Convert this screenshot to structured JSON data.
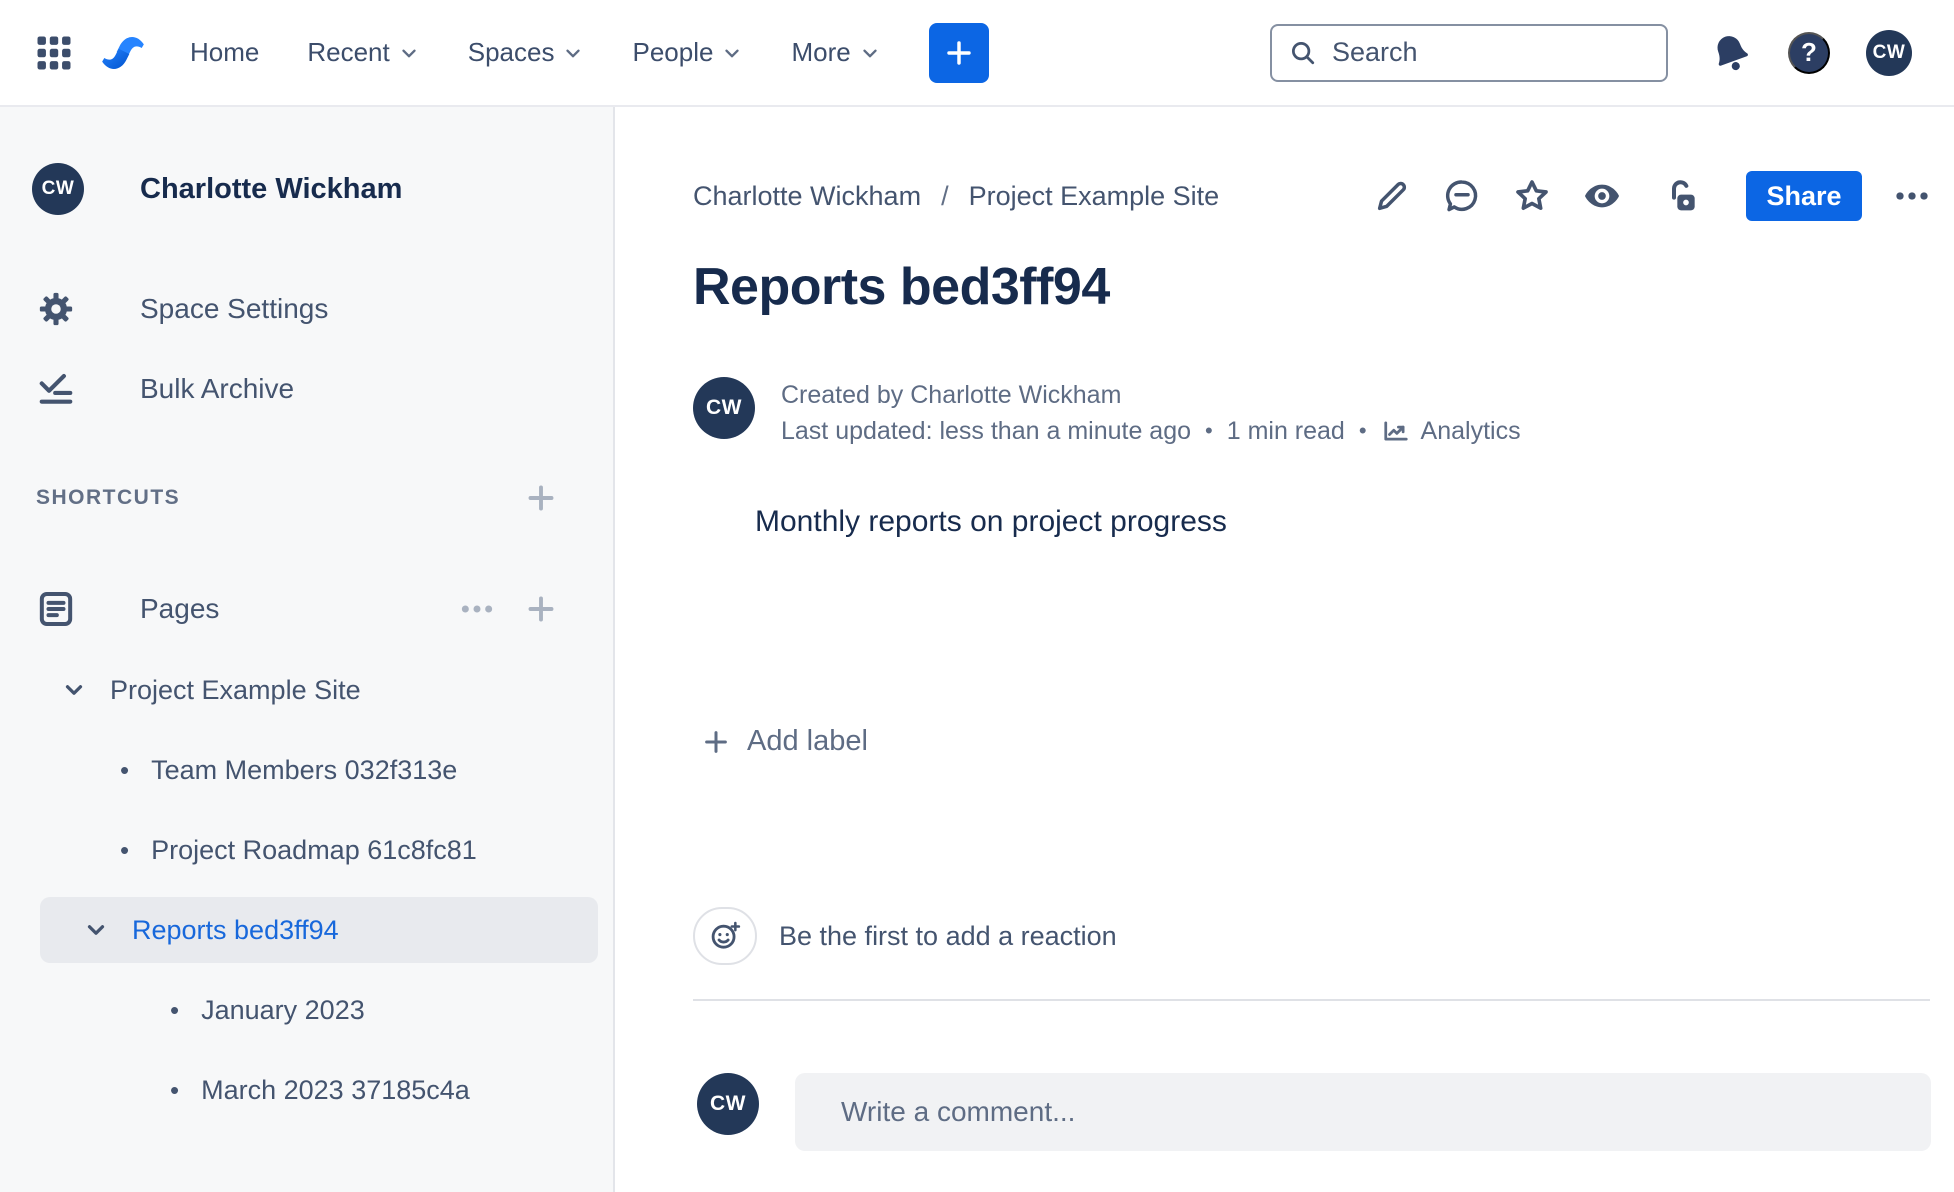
{
  "topbar": {
    "nav_items": [
      {
        "label": "Home",
        "dropdown": false
      },
      {
        "label": "Recent",
        "dropdown": true
      },
      {
        "label": "Spaces",
        "dropdown": true
      },
      {
        "label": "People",
        "dropdown": true
      },
      {
        "label": "More",
        "dropdown": true
      }
    ],
    "search": {
      "placeholder": "Search"
    },
    "help_glyph": "?",
    "avatar_initials": "CW"
  },
  "sidebar": {
    "space_avatar_initials": "CW",
    "space_name": "Charlotte Wickham",
    "menu_items": [
      {
        "label": "Space Settings"
      },
      {
        "label": "Bulk Archive"
      }
    ],
    "shortcuts_header": "SHORTCUTS",
    "pages_section_label": "Pages",
    "tree": {
      "root_label": "Project Example Site",
      "bullet_glyph": "•",
      "items": [
        {
          "label": "Team Members 032f313e"
        },
        {
          "label": "Project Roadmap 61c8fc81"
        },
        {
          "label": "Reports bed3ff94"
        },
        {
          "label": "January 2023"
        },
        {
          "label": "March 2023 37185c4a"
        }
      ],
      "selected_label": "Reports bed3ff94"
    }
  },
  "content": {
    "breadcrumb": {
      "items": [
        "Charlotte Wickham",
        "Project Example Site"
      ],
      "separator": "/"
    },
    "share_button_label": "Share",
    "page_title": "Reports bed3ff94",
    "byline": {
      "avatar_initials": "CW",
      "created_line": "Created by Charlotte Wickham",
      "updated_line": "Last updated: less than a minute ago",
      "separator": "•",
      "read_time": "1 min read",
      "analytics_label": "Analytics"
    },
    "body_text": "Monthly reports on project progress",
    "add_label_button": "Add label",
    "reactions_prompt": "Be the first to add a reaction",
    "comment": {
      "avatar_initials": "CW",
      "placeholder": "Write a comment..."
    }
  },
  "icons": {
    "app_switcher": "grid-3x3",
    "product_logo": "confluence",
    "create": "plus",
    "search": "magnifier",
    "notifications": "bell",
    "help": "question-mark-circle",
    "space_settings": "gear",
    "bulk_archive": "checkmark-list",
    "pages": "document",
    "expand": "chevron-down",
    "edit": "pencil",
    "comments": "speech-bubble",
    "favorite": "star-outline",
    "watch": "eye-filled",
    "restrictions": "unlocked-padlock",
    "more": "ellipsis",
    "analytics": "line-chart",
    "add_reaction": "smiley-plus"
  },
  "colors": {
    "brand_blue": "#0C66E4",
    "selected_blue": "#1868DB",
    "navy_avatar": "#233858",
    "icon_navy": "#44546F",
    "sidebar_bg": "#F7F8F9",
    "selected_row_bg": "#E8EAEE"
  }
}
